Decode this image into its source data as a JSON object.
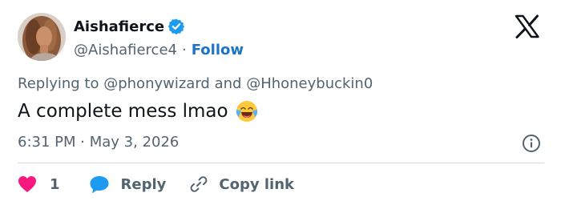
{
  "author": {
    "display_name": "Aishafierce",
    "handle": "@Aishafierce4",
    "separator": "·",
    "follow_label": "Follow",
    "verified_color": "#1d9bf0"
  },
  "reply_context": {
    "prefix": "Replying to",
    "mention_1": "@phonywizard",
    "conjunction": "and",
    "mention_2": "@Hhoneybuckin0"
  },
  "tweet": {
    "text": "A complete mess lmao",
    "emoji": "face-with-tears-of-joy"
  },
  "meta": {
    "time": "6:31 PM",
    "separator": "·",
    "date": "May 3, 2026"
  },
  "actions": {
    "like_count": "1",
    "reply_label": "Reply",
    "copy_link_label": "Copy link",
    "like_color": "#f91880",
    "reply_color": "#1d9bf0"
  }
}
